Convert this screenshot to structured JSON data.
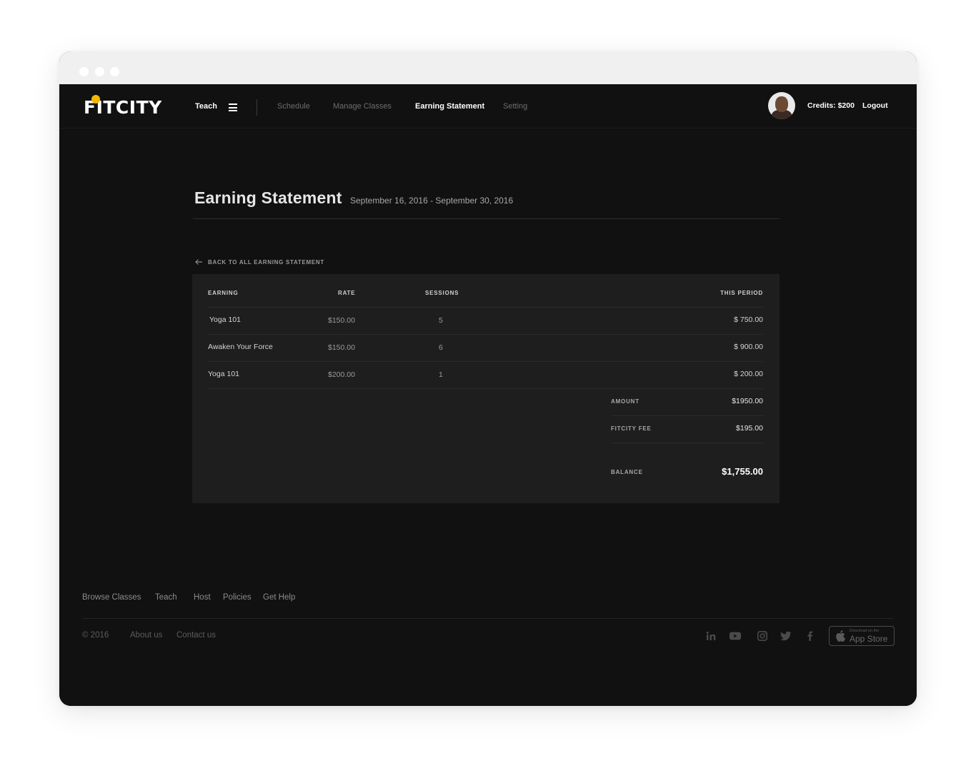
{
  "brand": {
    "logo_text": "FITCITY",
    "accent": "#f5b700"
  },
  "header": {
    "teach_label": "Teach",
    "nav": [
      "Schedule",
      "Manage Classes",
      "Earning Statement",
      "Setting"
    ],
    "active_nav": "Earning Statement",
    "credits": "Credits: $200",
    "logout": "Logout"
  },
  "page": {
    "title": "Earning Statement",
    "date_range": "September 16, 2016 - September 30, 2016",
    "back_link": "BACK TO ALL EARNING STATEMENT"
  },
  "table": {
    "headers": [
      "EARNING",
      "RATE",
      "SESSIONS",
      "THIS PERIOD"
    ],
    "rows": [
      {
        "earning": "Yoga 101",
        "rate": "$150.00",
        "sessions": "5",
        "this_period": "$ 750.00"
      },
      {
        "earning": "Awaken Your Force",
        "rate": "$150.00",
        "sessions": "6",
        "this_period": "$ 900.00"
      },
      {
        "earning": "Yoga 101",
        "rate": "$200.00",
        "sessions": "1",
        "this_period": "$ 200.00"
      }
    ],
    "amount_label": "AMOUNT",
    "amount_value": "$1950.00",
    "fee_label": "FITCITY FEE",
    "fee_value": "$195.00",
    "balance_label": "BALANCE",
    "balance_value": "$1,755.00"
  },
  "footer": {
    "links": [
      "Browse Classes",
      "Teach",
      "Host",
      "Policies",
      "Get Help"
    ],
    "copyright": "© 2016",
    "secondary_links": [
      "About us",
      "Contact us"
    ],
    "social_icons": [
      "linkedin-icon",
      "youtube-icon",
      "instagram-icon",
      "twitter-icon",
      "facebook-icon"
    ],
    "appstore_small": "Download on the",
    "appstore_big": "App Store"
  }
}
